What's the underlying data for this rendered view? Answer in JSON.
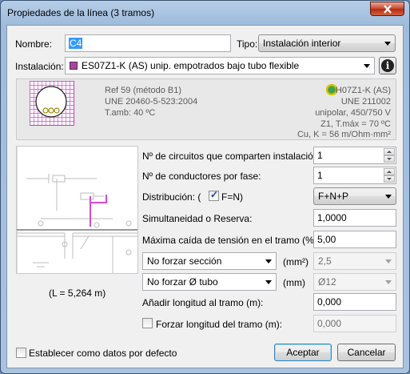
{
  "window": {
    "title": "Propiedades de la línea (3 tramos)"
  },
  "nombre": {
    "label": "Nombre:",
    "value": "C4"
  },
  "tipo": {
    "label": "Tipo:",
    "value": "Instalación interior"
  },
  "instalacion": {
    "label": "Instalación:",
    "value": "ES07Z1-K (AS) unip. empotrados bajo tubo flexible"
  },
  "info_panel": {
    "ref": "Ref 59 (método B1)",
    "une_left": "UNE 20460-5-523:2004",
    "tamb": "T.amb: 40 ºC",
    "cable": "H07Z1-K (AS)",
    "une_right": "UNE 211002",
    "type": "unipolar, 450/750 V",
    "z1": "Z1, T.máx = 70 ºC",
    "cu": "Cu, K = 56 m/Ohm·mm²"
  },
  "diagram": {
    "length_label": "(L = 5,264 m)"
  },
  "form": {
    "circuitos_label": "Nº de circuitos que comparten instalación:",
    "circuitos_value": "1",
    "conductores_label": "Nº de conductores por fase:",
    "conductores_value": "1",
    "distribucion_label": "Distribución: (",
    "fn_label": "F=N)",
    "distribucion_value": "F+N+P",
    "simultaneidad_label": "Simultaneidad o Reserva:",
    "simultaneidad_value": "1,0000",
    "caida_label": "Máxima caída de tensión en el tramo (%):",
    "caida_value": "5,00",
    "seccion_select": "No forzar sección",
    "seccion_unit": "(mm²)",
    "seccion_value": "2,5",
    "tubo_select": "No forzar Ø tubo",
    "tubo_unit": "(mm)",
    "tubo_value": "Ø12",
    "anadir_label": "Añadir longitud al tramo (m):",
    "anadir_value": "0,000",
    "forzar_label": "Forzar longitud del tramo (m):",
    "forzar_value": "0,000"
  },
  "footer": {
    "default_label": "Establecer como datos por defecto",
    "accept": "Aceptar",
    "cancel": "Cancelar"
  },
  "colors": {
    "cable_icon": "#a6459e",
    "conductor_ring": "#d9c300",
    "conductor_inner": "#3fa34d",
    "grid": "#d64ad0"
  },
  "icons": [
    "close-icon",
    "info-icon",
    "cable-type-icon",
    "conductor-icon"
  ]
}
